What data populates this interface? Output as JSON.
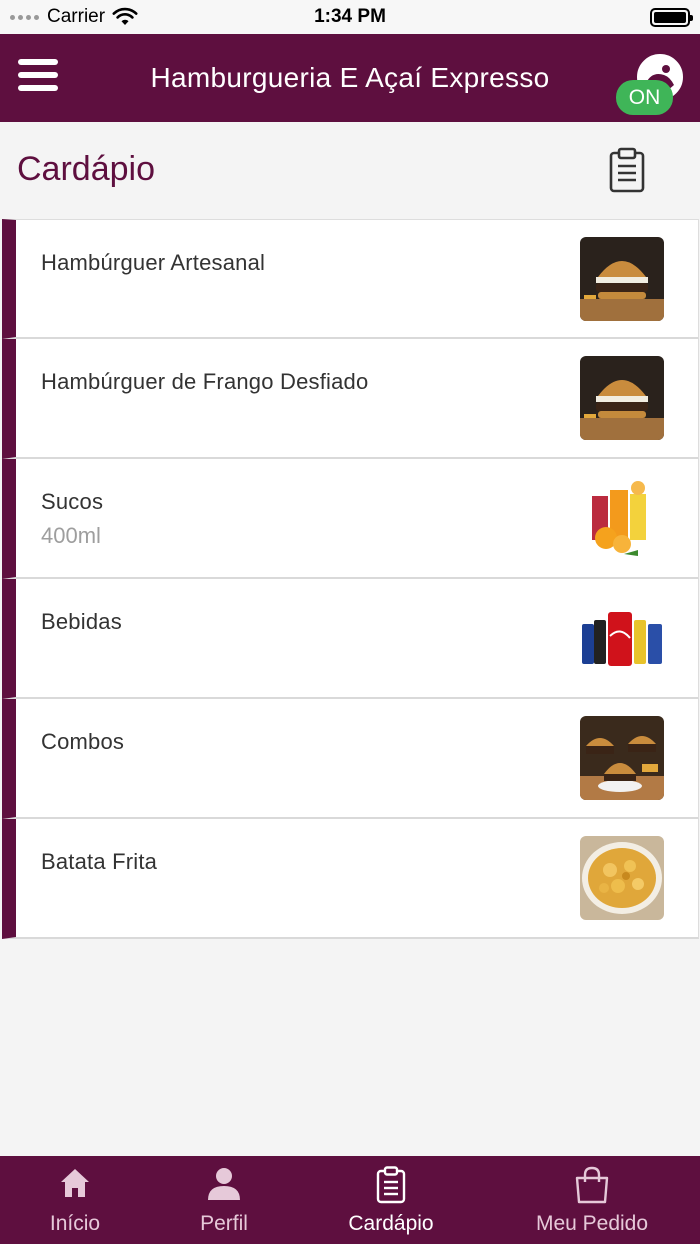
{
  "status_bar": {
    "carrier": "Carrier",
    "time": "1:34 PM"
  },
  "header": {
    "title": "Hamburgueria E Açaí Expresso",
    "status_badge": "ON"
  },
  "page": {
    "title": "Cardápio"
  },
  "menu": {
    "items": [
      {
        "name": "Hambúrguer Artesanal",
        "description": "",
        "image_icon": "burger-image"
      },
      {
        "name": "Hambúrguer de Frango Desfiado",
        "description": "",
        "image_icon": "burger-image"
      },
      {
        "name": "Sucos",
        "description": "400ml",
        "image_icon": "juice-image"
      },
      {
        "name": "Bebidas",
        "description": "",
        "image_icon": "soda-cans-image"
      },
      {
        "name": "Combos",
        "description": "",
        "image_icon": "combo-image"
      },
      {
        "name": "Batata Frita",
        "description": "",
        "image_icon": "fries-image"
      }
    ]
  },
  "tabbar": {
    "active": "cardapio",
    "tabs": [
      {
        "id": "inicio",
        "label": "Início",
        "icon": "home-icon"
      },
      {
        "id": "perfil",
        "label": "Perfil",
        "icon": "person-icon"
      },
      {
        "id": "cardapio",
        "label": "Cardápio",
        "icon": "clipboard-icon"
      },
      {
        "id": "meu-pedido",
        "label": "Meu Pedido",
        "icon": "shopping-bag-icon"
      }
    ]
  },
  "colors": {
    "brand": "#5e0f3f",
    "status_on": "#3fb558",
    "background": "#f4f4f4"
  }
}
